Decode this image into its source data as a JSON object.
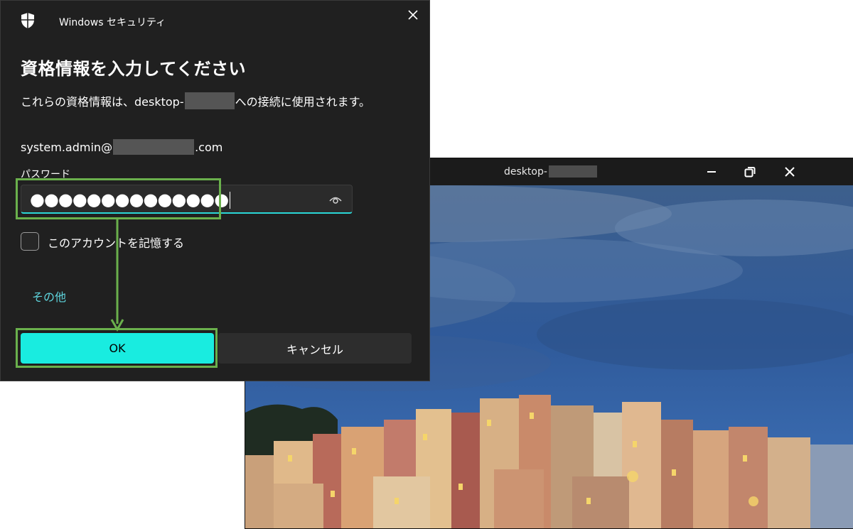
{
  "remote_window": {
    "title": "desktop-",
    "controls": {
      "minimize_icon": "minimize-icon",
      "restore_icon": "restore-icon",
      "close_icon": "close-icon"
    },
    "wallpaper": "coastal village houses on cliff at dusk under blue cloudy sky"
  },
  "dialog": {
    "app_title": "Windows セキュリティ",
    "heading": "資格情報を入力してください",
    "description_prefix": "これらの資格情報は、desktop-",
    "description_suffix": "への接続に使用されます。",
    "username_prefix": "system.admin@",
    "username_suffix": ".com",
    "password_label": "パスワード",
    "password_value": "●●●●●●●●●●●●●●",
    "remember_label": "このアカウントを記憶する",
    "remember_checked": false,
    "more_choices": "その他",
    "ok_label": "OK",
    "cancel_label": "キャンセル"
  },
  "colors": {
    "dialog_bg": "#202020",
    "accent": "#19ece0",
    "link": "#5ed5dd",
    "annotation": "#6ab04c"
  }
}
